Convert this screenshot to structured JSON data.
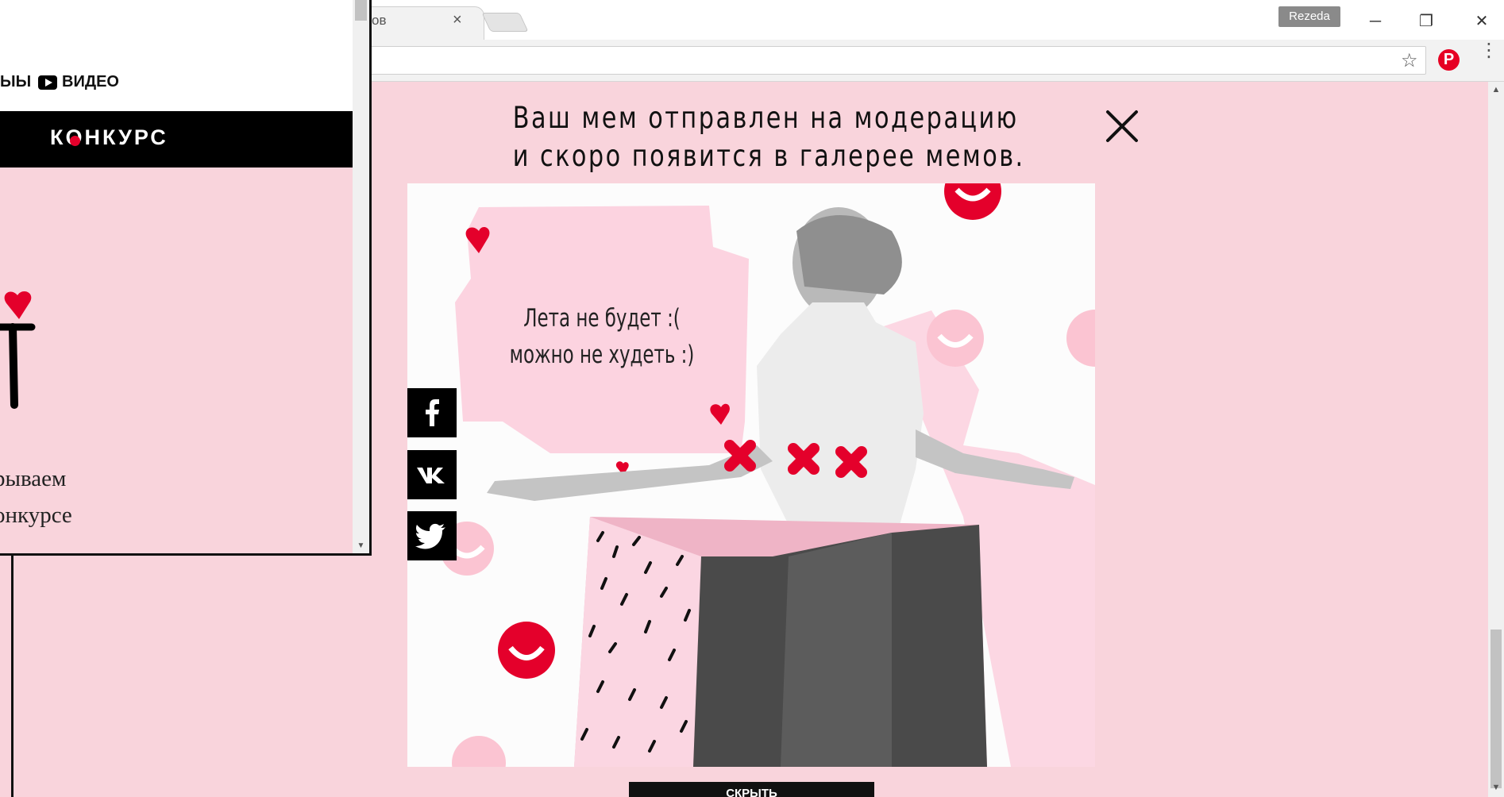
{
  "browser": {
    "tab_title": "ов",
    "tab_close": "×",
    "profile_name": "Rezeda",
    "min_glyph": "─",
    "max_glyph": "❐",
    "close_glyph": "✕",
    "star_glyph": "☆",
    "pinterest_glyph": "P",
    "menu_glyph": "⋮"
  },
  "modal": {
    "title_line1": "Ваш мем отправлен на модерацию",
    "title_line2": "и скоро появится в галерее мемов.",
    "meme_text_line1": "Лета не будет :(",
    "meme_text_line2": "можно не худеть :)",
    "bottom_button": "СКРЫТЬ"
  },
  "share": {
    "facebook_glyph": "f",
    "vk_glyph": "vk",
    "twitter_glyph": "t"
  },
  "popup": {
    "nav_prev": "ЫЫ",
    "nav_video": "ВИДЕО",
    "banner_text": "КОНКУРС",
    "paragraph_line1": "рываем",
    "paragraph_line2": "онкурсе"
  },
  "colors": {
    "page_bg": "#f9d4dc",
    "accent_red": "#e4002b",
    "pink_light": "#fcd3e0",
    "black": "#000000"
  }
}
